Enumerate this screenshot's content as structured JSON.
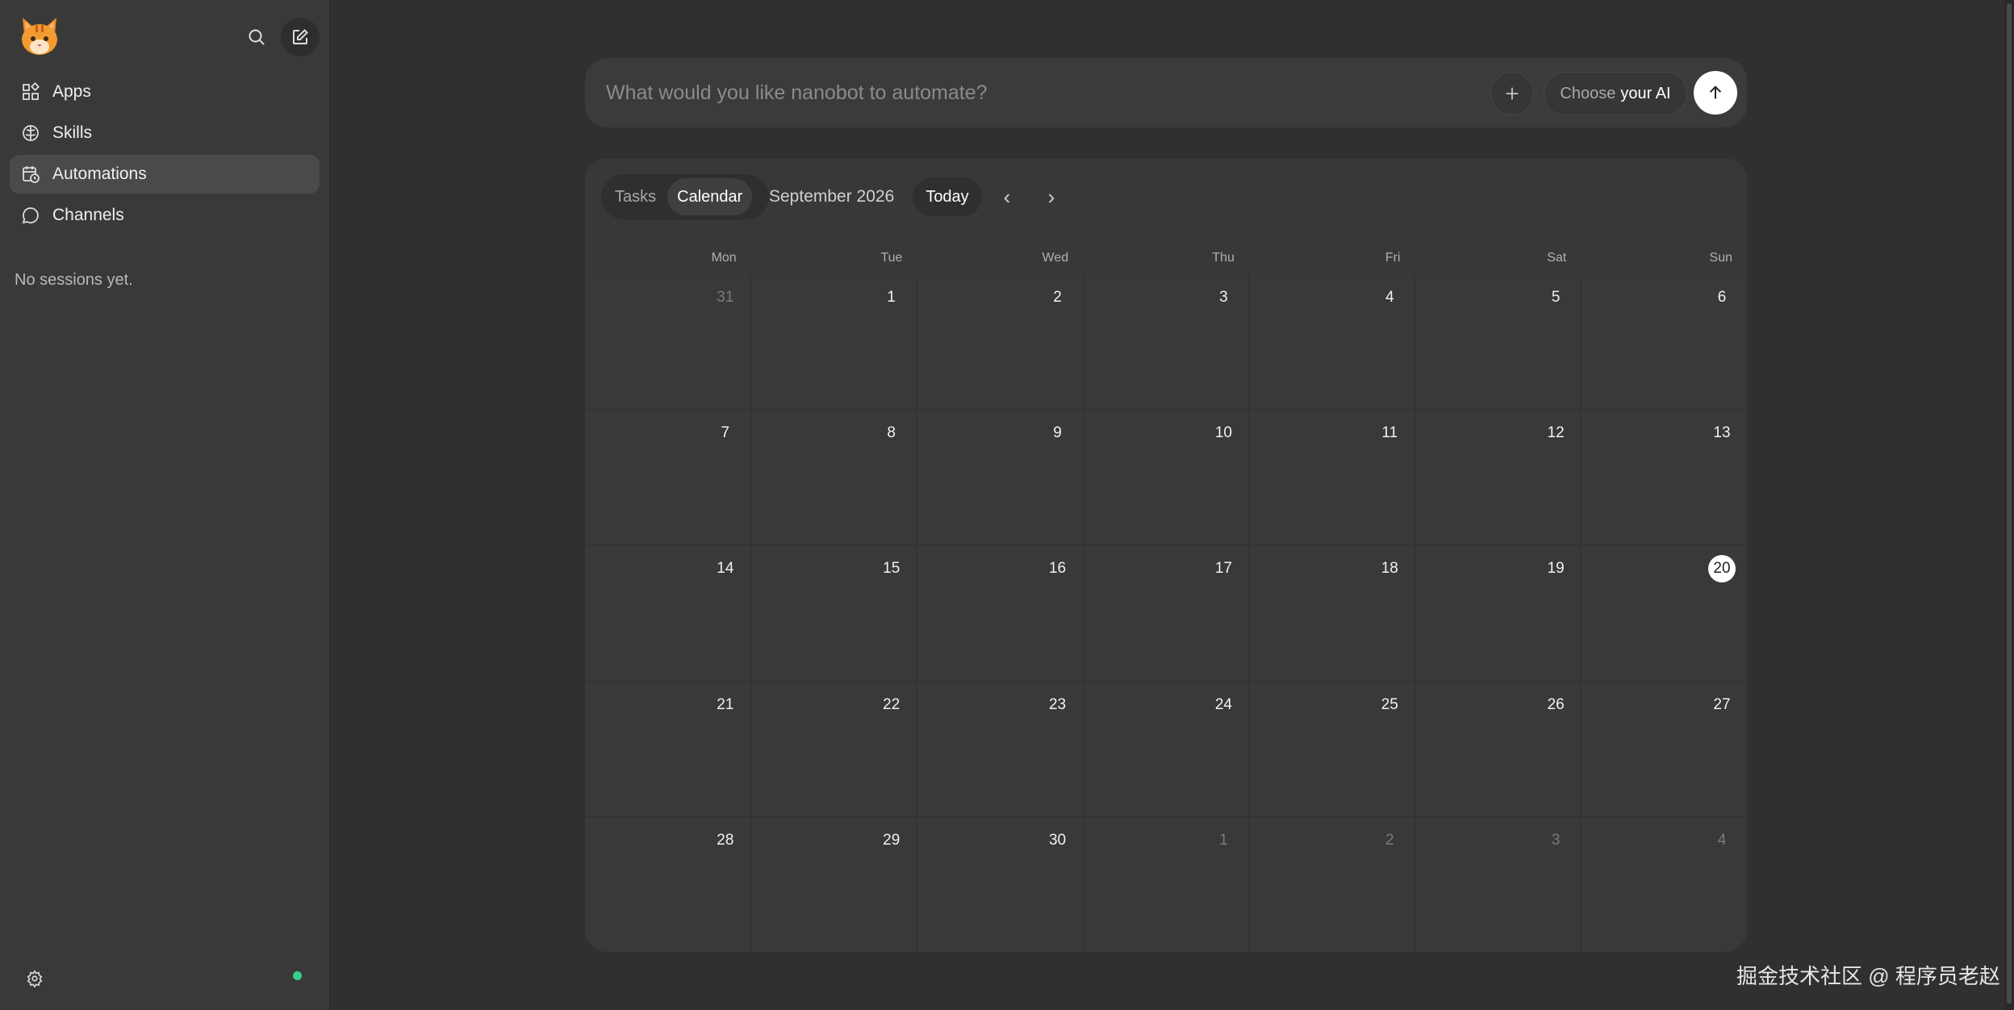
{
  "sidebar": {
    "nav": [
      {
        "label": "Apps",
        "icon": "apps-icon"
      },
      {
        "label": "Skills",
        "icon": "brain-icon"
      },
      {
        "label": "Automations",
        "icon": "calendar-clock-icon",
        "active": true
      },
      {
        "label": "Channels",
        "icon": "chat-bubble-icon"
      }
    ],
    "empty_sessions": "No sessions yet.",
    "status_color": "#35d08a"
  },
  "prompt": {
    "placeholder": "What would you like nanobot to automate?",
    "choose_ai_prefix": "Choose",
    "choose_ai_suffix": "your AI"
  },
  "calendar": {
    "tabs": [
      {
        "label": "Tasks"
      },
      {
        "label": "Calendar",
        "active": true
      }
    ],
    "month": "September 2026",
    "today_label": "Today",
    "prev_label": "‹",
    "next_label": "›",
    "weekdays": [
      "Mon",
      "Tue",
      "Wed",
      "Thu",
      "Fri",
      "Sat",
      "Sun"
    ],
    "weeks": [
      [
        {
          "d": "31",
          "out": true
        },
        {
          "d": "1"
        },
        {
          "d": "2"
        },
        {
          "d": "3"
        },
        {
          "d": "4"
        },
        {
          "d": "5"
        },
        {
          "d": "6"
        }
      ],
      [
        {
          "d": "7"
        },
        {
          "d": "8"
        },
        {
          "d": "9"
        },
        {
          "d": "10"
        },
        {
          "d": "11"
        },
        {
          "d": "12"
        },
        {
          "d": "13"
        }
      ],
      [
        {
          "d": "14"
        },
        {
          "d": "15"
        },
        {
          "d": "16"
        },
        {
          "d": "17"
        },
        {
          "d": "18"
        },
        {
          "d": "19"
        },
        {
          "d": "20",
          "today": true
        }
      ],
      [
        {
          "d": "21"
        },
        {
          "d": "22"
        },
        {
          "d": "23"
        },
        {
          "d": "24"
        },
        {
          "d": "25"
        },
        {
          "d": "26"
        },
        {
          "d": "27"
        }
      ],
      [
        {
          "d": "28"
        },
        {
          "d": "29"
        },
        {
          "d": "30"
        },
        {
          "d": "1",
          "out": true
        },
        {
          "d": "2",
          "out": true
        },
        {
          "d": "3",
          "out": true
        },
        {
          "d": "4",
          "out": true
        }
      ]
    ]
  },
  "watermark": "掘金技术社区 @ 程序员老赵"
}
